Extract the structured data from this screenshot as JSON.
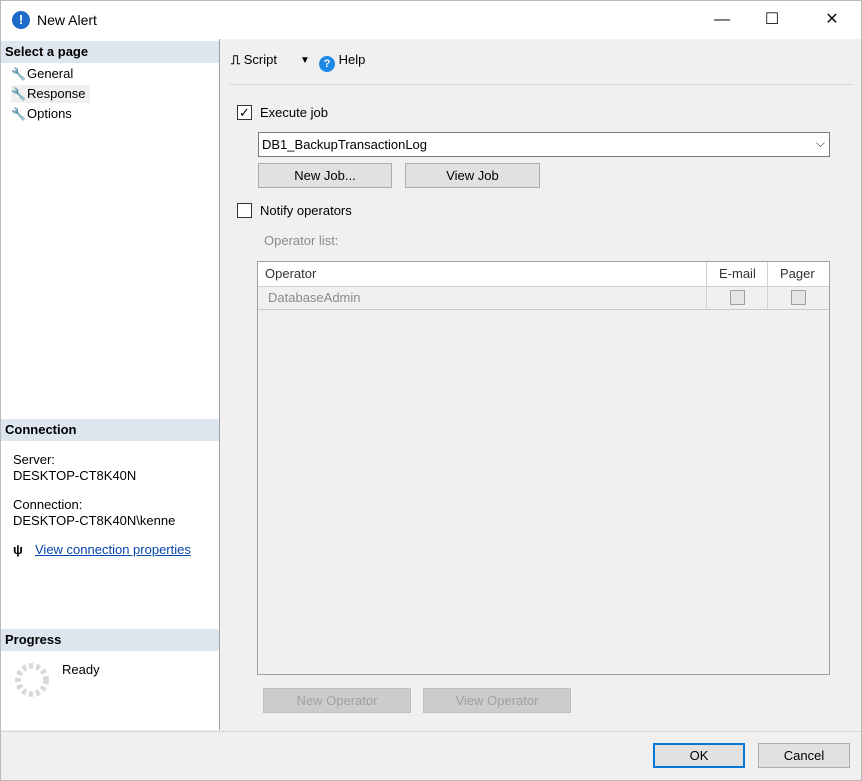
{
  "window": {
    "title": "New Alert",
    "title_icon": "!",
    "minimize": "—",
    "maximize": "☐",
    "close": "✕"
  },
  "left": {
    "select_page_header": "Select a page",
    "pages": [
      {
        "label": "General"
      },
      {
        "label": "Response"
      },
      {
        "label": "Options"
      }
    ],
    "connection_header": "Connection",
    "server_label": "Server:",
    "server_value": "DESKTOP-CT8K40N",
    "connection_label": "Connection:",
    "connection_value": "DESKTOP-CT8K40N\\kenne",
    "view_props_link": "View connection properties",
    "progress_header": "Progress",
    "progress_status": "Ready"
  },
  "toolbar": {
    "script_label": "Script",
    "help_label": "Help"
  },
  "response": {
    "execute_job_label": "Execute job",
    "execute_job_checked": true,
    "job_selected": "DB1_BackupTransactionLog",
    "new_job_button": "New Job...",
    "view_job_button": "View Job",
    "notify_operators_label": "Notify operators",
    "notify_operators_checked": false,
    "operator_list_label": "Operator list:",
    "columns": {
      "operator": "Operator",
      "email": "E-mail",
      "pager": "Pager"
    },
    "rows": [
      {
        "operator": "DatabaseAdmin",
        "email": false,
        "pager": false
      }
    ],
    "new_operator_button": "New Operator",
    "view_operator_button": "View Operator"
  },
  "footer": {
    "ok_button": "OK",
    "cancel_button": "Cancel"
  },
  "colors": {
    "accent": "#0078d7",
    "section_header": "#dde6ef",
    "link": "#0645ad"
  }
}
